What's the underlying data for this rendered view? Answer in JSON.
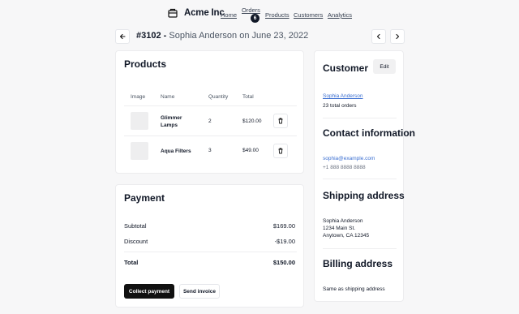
{
  "header": {
    "brand": "Acme Inc",
    "nav": [
      {
        "label": "Home"
      },
      {
        "label": "Orders",
        "badge": "6"
      },
      {
        "label": "Products"
      },
      {
        "label": "Customers"
      },
      {
        "label": "Analytics"
      }
    ]
  },
  "page": {
    "order_number": "#3102 -",
    "subtitle": "Sophia Anderson on June 23, 2022"
  },
  "products": {
    "title": "Products",
    "columns": [
      "Image",
      "Name",
      "Quantity",
      "Total"
    ],
    "rows": [
      {
        "name": "Glimmer Lamps",
        "quantity": "2",
        "total": "$120.00"
      },
      {
        "name": "Aqua Filters",
        "quantity": "3",
        "total": "$49.00"
      }
    ]
  },
  "payment": {
    "title": "Payment",
    "subtotal_label": "Subtotal",
    "subtotal_value": "$169.00",
    "discount_label": "Discount",
    "discount_value": "-$19.00",
    "total_label": "Total",
    "total_value": "$150.00",
    "collect_label": "Collect payment",
    "invoice_label": "Send invoice"
  },
  "customer": {
    "title": "Customer",
    "edit_label": "Edit",
    "name": "Sophia Anderson",
    "orders": "23 total orders",
    "contact_title": "Contact information",
    "email": "sophia@example.com",
    "phone": "+1 888 8888 8888",
    "shipping_title": "Shipping address",
    "shipping_lines": [
      "Sophia Anderson",
      "1234 Main St.",
      "Anytown, CA 12345"
    ],
    "billing_title": "Billing address",
    "billing_text": "Same as shipping address"
  },
  "colors": {
    "accent_link": "#3b6fd1",
    "primary_button": "#111111",
    "background": "#f7f7f8"
  }
}
